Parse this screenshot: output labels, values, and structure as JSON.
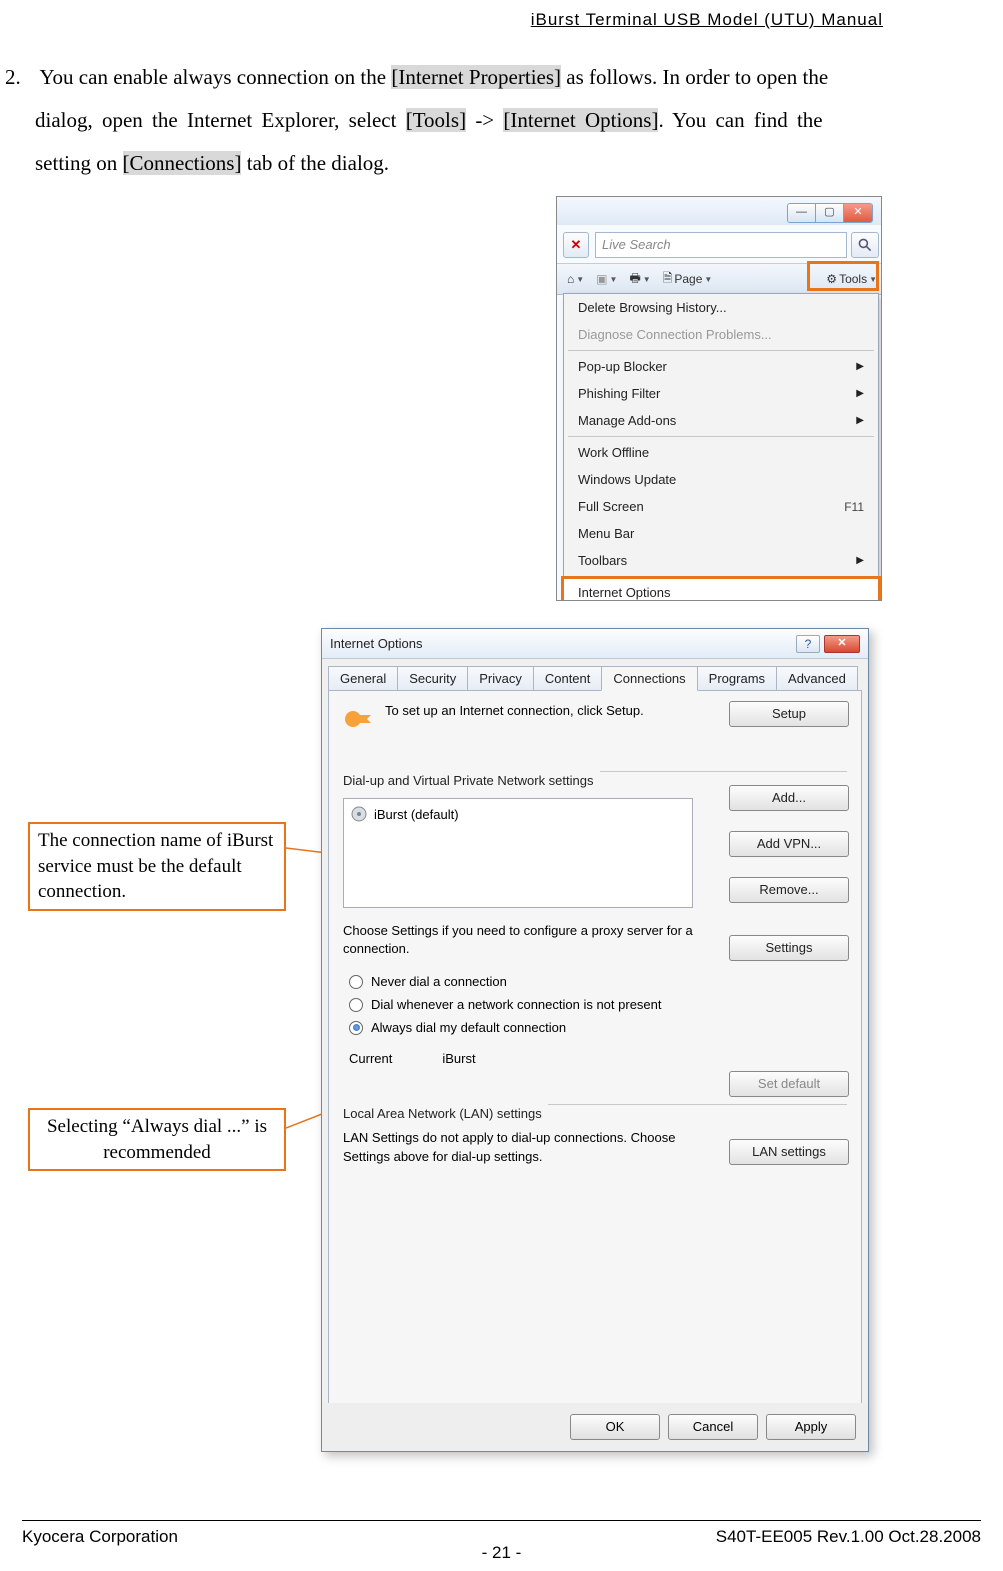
{
  "header": "iBurst  Terminal  USB  Model  (UTU)  Manual",
  "step_num": "2.",
  "para": {
    "pre1": "You can enable always connection on the ",
    "hl1": "[Internet Properties]",
    "post1": " as follows.    In order to open the",
    "l2a": "dialog,  open  the  Internet  Explorer,  select  ",
    "hl2": "[Tools]",
    "l2b": "  ->  ",
    "hl3": "[Internet  Options]",
    "l2c": ".    You  can  find  the",
    "l3a": "setting on ",
    "hl4": "[Connections]",
    "l3b": " tab of the dialog."
  },
  "ie": {
    "search_placeholder": "Live Search",
    "page_label": "Page",
    "tools_label": "Tools",
    "menu": {
      "delete_history": "Delete Browsing History...",
      "diagnose": "Diagnose Connection Problems...",
      "popup": "Pop-up Blocker",
      "phishing": "Phishing Filter",
      "addons": "Manage Add-ons",
      "offline": "Work Offline",
      "winupdate": "Windows Update",
      "fullscreen": "Full Screen",
      "fullscreen_key": "F11",
      "menubar": "Menu Bar",
      "toolbars": "Toolbars",
      "internet_options": "Internet Options"
    }
  },
  "callout1": "The connection name of iBurst service must be the default connection.",
  "callout2": "Selecting “Always dial ...” is recommended",
  "io": {
    "title": "Internet Options",
    "tabs": {
      "general": "General",
      "security": "Security",
      "privacy": "Privacy",
      "content": "Content",
      "connections": "Connections",
      "programs": "Programs",
      "advanced": "Advanced"
    },
    "setup_text": "To set up an Internet connection, click Setup.",
    "setup_btn": "Setup",
    "dialup_label": "Dial-up and Virtual Private Network settings",
    "default_item": "iBurst (default)",
    "add_btn": "Add...",
    "addvpn_btn": "Add VPN...",
    "remove_btn": "Remove...",
    "proxy_text": "Choose Settings if you need to configure a proxy server for a connection.",
    "settings_btn": "Settings",
    "radio_never": "Never dial a connection",
    "radio_whenever": "Dial whenever a network connection is not present",
    "radio_always": "Always dial my default connection",
    "current_label": "Current",
    "current_value": "iBurst",
    "setdefault_btn": "Set default",
    "lan_label": "Local Area Network (LAN) settings",
    "lan_text": "LAN Settings do not apply to dial-up connections. Choose Settings above for dial-up settings.",
    "lan_btn": "LAN settings",
    "ok": "OK",
    "cancel": "Cancel",
    "apply": "Apply"
  },
  "footer_left": "Kyocera Corporation",
  "footer_right": "S40T-EE005 Rev.1.00 Oct.28.2008",
  "page": "- 21 -"
}
